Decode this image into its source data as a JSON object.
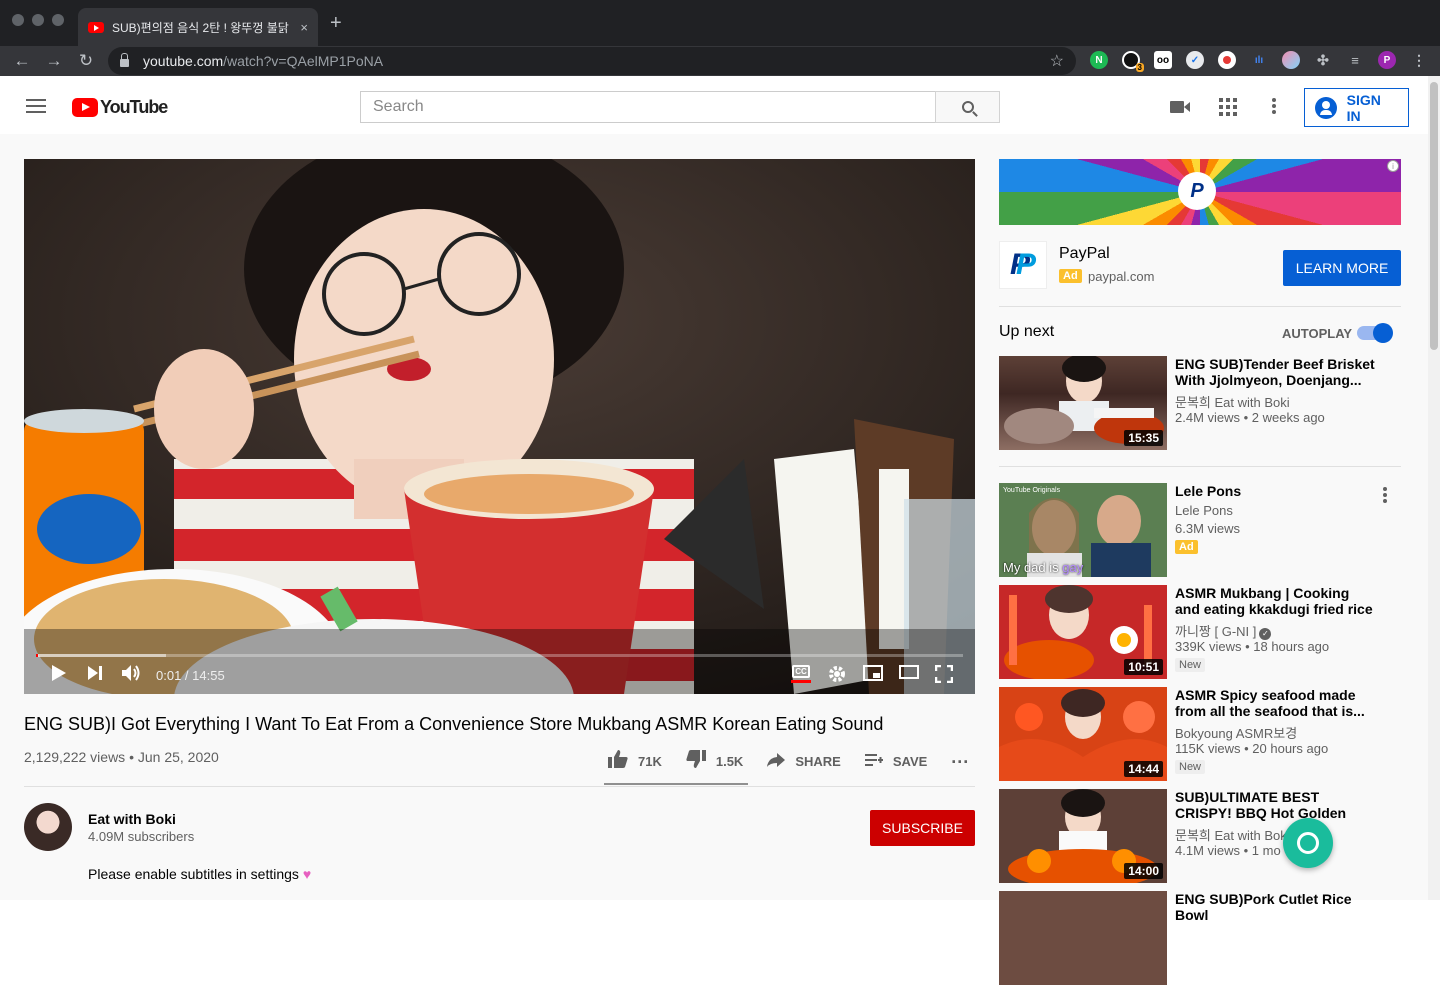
{
  "browser": {
    "tab_title": "SUB)편의점 음식 2탄 ! 왕뚜껑 불닭",
    "url_host": "youtube.com",
    "url_path": "/watch?v=QAelMP1PoNA",
    "new_tab": "+",
    "close": "×",
    "ext_badge": "3",
    "profile_initial": "P"
  },
  "header": {
    "logo_text": "YouTube",
    "search_placeholder": "Search",
    "signin_label": "SIGN IN"
  },
  "player": {
    "current_time": "0:01",
    "duration": "14:55",
    "time_display": "0:01 / 14:55",
    "cc_label": "CC"
  },
  "video": {
    "title": "ENG SUB)I Got Everything I Want To Eat From a Convenience Store Mukbang ASMR Korean Eating Sound",
    "views": "2,129,222 views",
    "date": "Jun 25, 2020",
    "meta": "2,129,222 views • Jun 25, 2020",
    "likes": "71K",
    "dislikes": "1.5K",
    "share_label": "SHARE",
    "save_label": "SAVE",
    "more": "..."
  },
  "channel": {
    "name": "Eat with Boki",
    "subscribers": "4.09M subscribers",
    "subscribe_label": "SUBSCRIBE",
    "description": "Please enable subtitles in settings"
  },
  "ad": {
    "advertiser": "PayPal",
    "badge": "Ad",
    "url": "paypal.com",
    "cta": "LEARN MORE",
    "info": "i",
    "logo_letter": "P"
  },
  "sidebar": {
    "up_next_label": "Up next",
    "autoplay_label": "AUTOPLAY",
    "autoplay_on": true,
    "items": [
      {
        "title": "ENG SUB)Tender Beef Brisket With Jjolmyeon, Doenjang...",
        "channel": "문복희 Eat with Boki",
        "meta": "2.4M views • 2 weeks ago",
        "duration": "15:35"
      },
      {
        "title": "Lele Pons",
        "channel": "Lele Pons",
        "meta": "6.3M views",
        "badge": "Ad",
        "caption_a": "My dad is",
        "caption_b": "gay",
        "thumb_tag": "YouTube Originals"
      },
      {
        "title": "ASMR Mukbang | Cooking and eating kkakdugi fried rice and...",
        "channel": "까니짱 [ G-NI ]",
        "meta": "339K views • 18 hours ago",
        "duration": "10:51",
        "badge": "New"
      },
      {
        "title": "ASMR Spicy seafood made from all the seafood that is...",
        "channel": "Bokyoung ASMR보경",
        "meta": "115K views • 20 hours ago",
        "duration": "14:44",
        "badge": "New"
      },
      {
        "title": "SUB)ULTIMATE BEST CRISPY! BBQ Hot Golden Olive Fried &...",
        "channel": "문복희 Eat with Boki",
        "meta": "4.1M views • 1 mo",
        "duration": "14:00"
      },
      {
        "title": "ENG SUB)Pork Cutlet Rice Bowl"
      }
    ]
  },
  "colors": {
    "brand_red": "#ff0000",
    "subscribe_red": "#cc0000",
    "link_blue": "#065fd4",
    "ad_yellow": "#fbc02d"
  }
}
